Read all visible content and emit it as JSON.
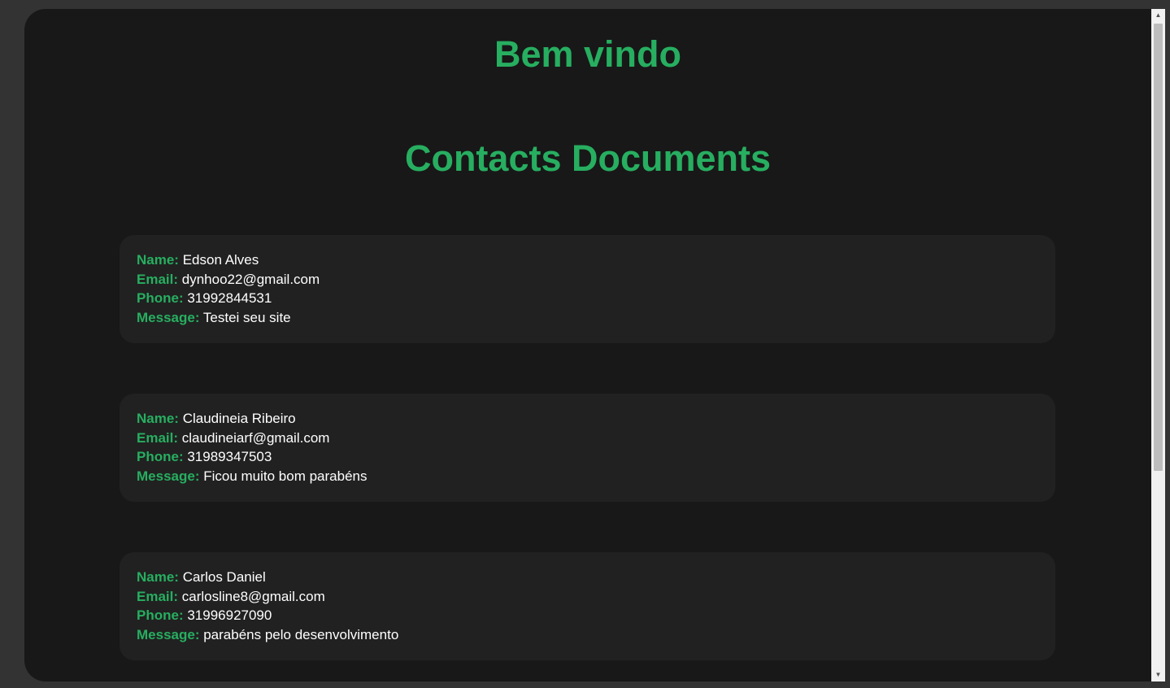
{
  "header": {
    "welcome": "Bem vindo",
    "title": "Contacts Documents"
  },
  "labels": {
    "name": "Name:",
    "email": "Email:",
    "phone": "Phone:",
    "message": "Message:"
  },
  "contacts": [
    {
      "name": "Edson Alves",
      "email": "dynhoo22@gmail.com",
      "phone": "31992844531",
      "message": "Testei seu site"
    },
    {
      "name": "Claudineia Ribeiro",
      "email": "claudineiarf@gmail.com",
      "phone": "31989347503",
      "message": "Ficou muito bom parabéns"
    },
    {
      "name": "Carlos Daniel",
      "email": "carlosline8@gmail.com",
      "phone": "31996927090",
      "message": "parabéns pelo desenvolvimento"
    }
  ],
  "scrollbar": {
    "up_icon": "▲",
    "down_icon": "▼"
  },
  "colors": {
    "accent": "#27ae60",
    "background": "#181818",
    "card": "#212121"
  }
}
